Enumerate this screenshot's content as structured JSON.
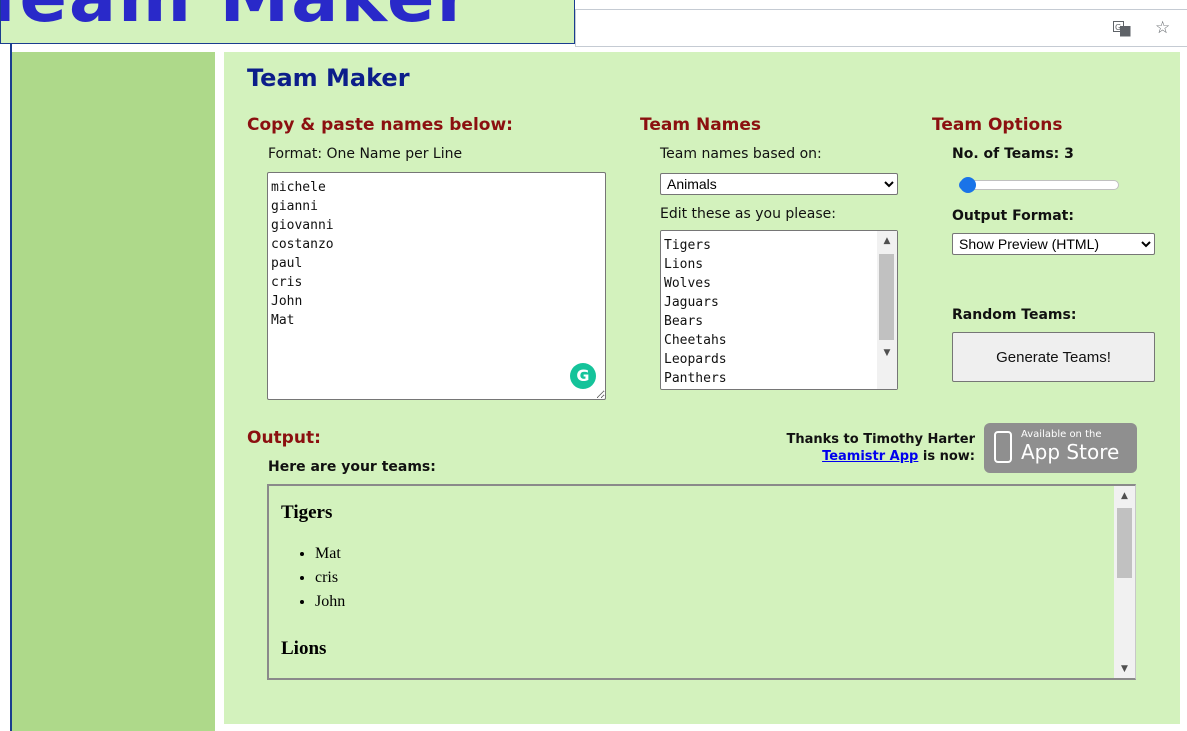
{
  "banner": {
    "text": "Team Maker"
  },
  "browser": {
    "translate_icon": "translate-icon",
    "star_icon": "star-icon"
  },
  "page": {
    "title": "Team Maker"
  },
  "names_section": {
    "heading": "Copy & paste names below:",
    "format_label": "Format: One Name per Line",
    "names_text": "michele\ngianni\ngiovanni\ncostanzo\npaul\ncris\nJohn\nMat"
  },
  "team_names_section": {
    "heading": "Team Names",
    "based_on_label": "Team names based on:",
    "based_on_selected": "Animals",
    "edit_label": "Edit these as you please:",
    "team_names_text": "Tigers\nLions\nWolves\nJaguars\nBears\nCheetahs\nLeopards\nPanthers"
  },
  "options_section": {
    "heading": "Team Options",
    "num_teams_label": "No. of Teams: 3",
    "num_teams_value": 3,
    "output_format_label": "Output Format:",
    "output_format_selected": "Show Preview (HTML)",
    "random_label": "Random Teams:",
    "generate_label": "Generate Teams!"
  },
  "output_section": {
    "heading": "Output:",
    "intro": "Here are your teams:",
    "thanks_line": "Thanks to Timothy Harter",
    "app_link": "Teamistr App",
    "is_now": " is now:",
    "appstore_small": "Available on the",
    "appstore_big": "App Store",
    "teams": [
      {
        "name": "Tigers",
        "members": [
          "Mat",
          "cris",
          "John"
        ]
      },
      {
        "name": "Lions",
        "members": []
      }
    ]
  },
  "colors": {
    "panel": "#d3f2bd",
    "left_strip": "#aed98a",
    "heading_red": "#8b1010",
    "title_blue": "#0c1e8a"
  }
}
